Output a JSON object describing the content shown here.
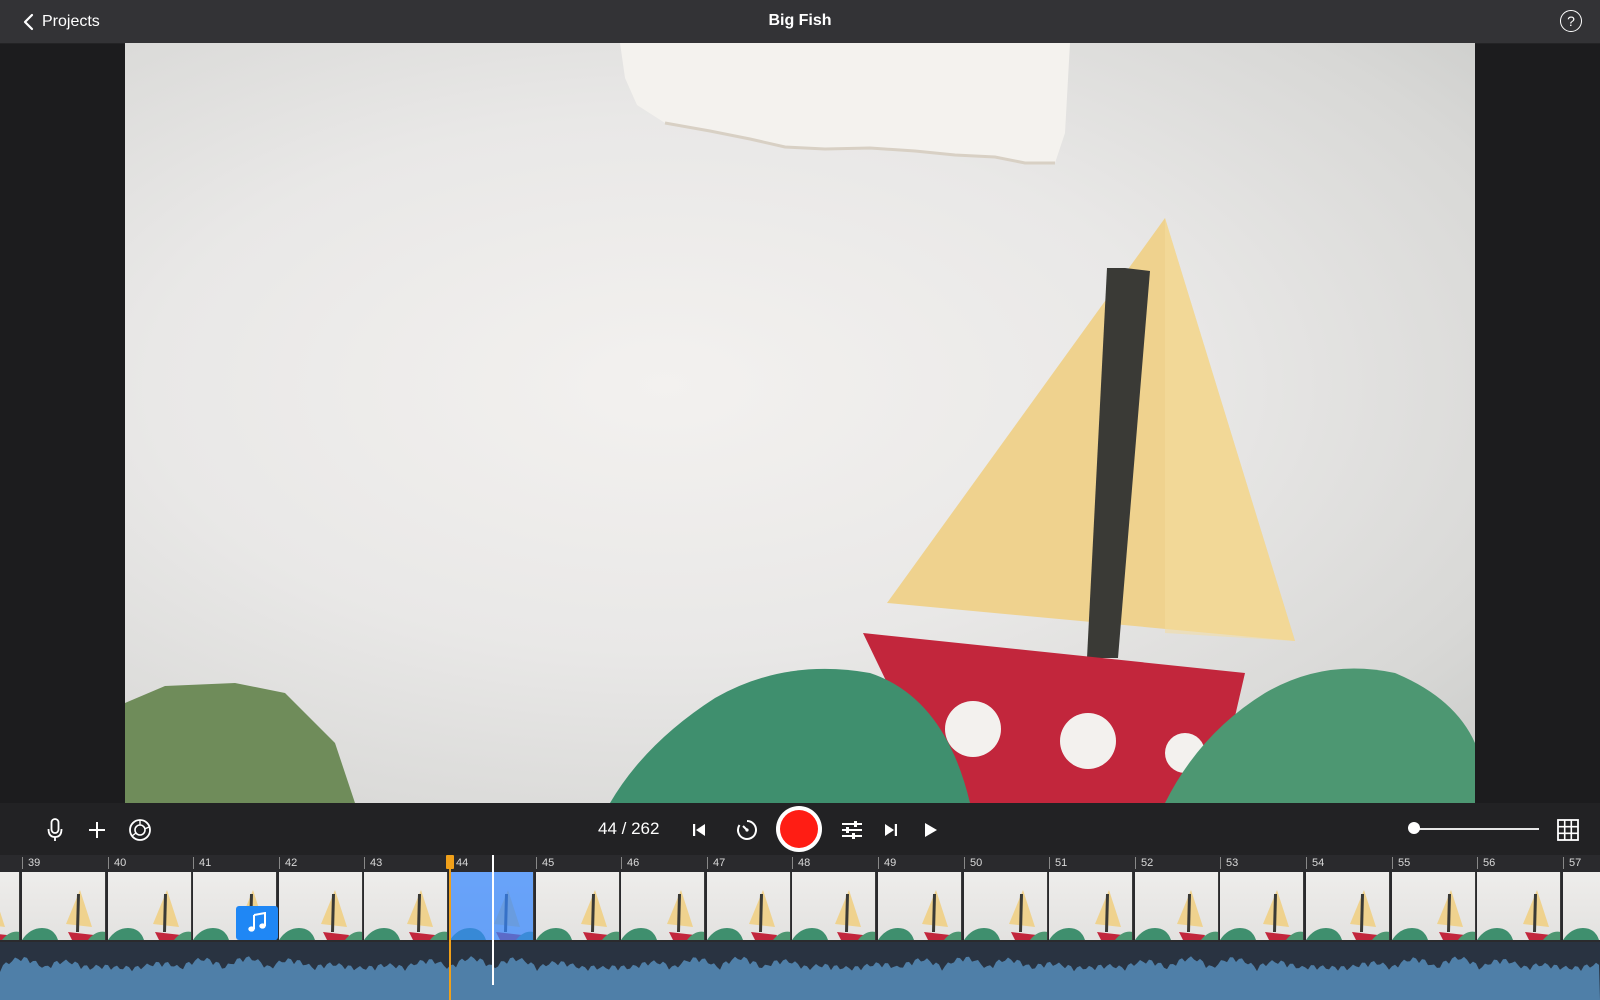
{
  "titlebar": {
    "back_label": "Projects",
    "title": "Big Fish",
    "help_label": "?"
  },
  "toolbar": {
    "current_frame": 44,
    "total_frames": 262,
    "frame_counter": "44 / 262",
    "icons": [
      "microphone-icon",
      "add-icon",
      "camera-settings-icon",
      "skip-to-start-icon",
      "timer-icon",
      "record-button",
      "adjustments-icon",
      "skip-to-end-icon",
      "play-icon",
      "grid-icon"
    ],
    "zoom_level": 0.0,
    "record_color": "#ff1d14"
  },
  "timeline": {
    "ruler_labels": [
      "39",
      "40",
      "41",
      "42",
      "43",
      "44",
      "45",
      "46",
      "47",
      "48",
      "49",
      "50",
      "51",
      "52",
      "53",
      "54",
      "55",
      "56",
      "57"
    ],
    "selected_frame": "44",
    "accent_selected": "#3487ff",
    "playhead_color": "#f0a01a"
  }
}
